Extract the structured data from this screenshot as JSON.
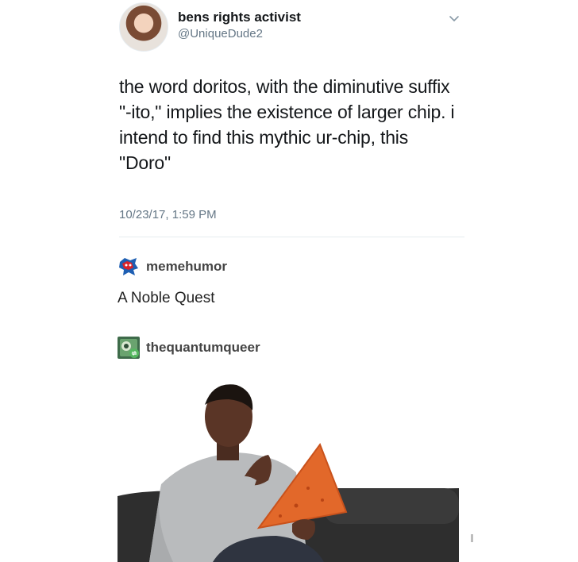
{
  "tweet": {
    "display_name": "bens rights activist",
    "handle": "@UniqueDude2",
    "text": "the word doritos, with the diminutive suffix \"-ito,\" implies the existence of larger chip. i intend to find this mythic ur-chip, this \"Doro\"",
    "timestamp": "10/23/17, 1:59 PM",
    "avatar_icon": "avatar-photo-woman",
    "menu_icon": "chevron-down-icon"
  },
  "reblogs": [
    {
      "username": "memehumor",
      "text": "A Noble Quest",
      "avatar_icon": "memehumor-avatar"
    },
    {
      "username": "thequantumqueer",
      "avatar_icon": "thequantumqueer-avatar",
      "badge_icon": "reblog-icon"
    }
  ],
  "photo": {
    "subject": "man holding giant tortilla chip",
    "colors": {
      "chip": "#e2682a",
      "sweater": "#b9bbbd",
      "sofa": "#2e2e2e"
    }
  }
}
